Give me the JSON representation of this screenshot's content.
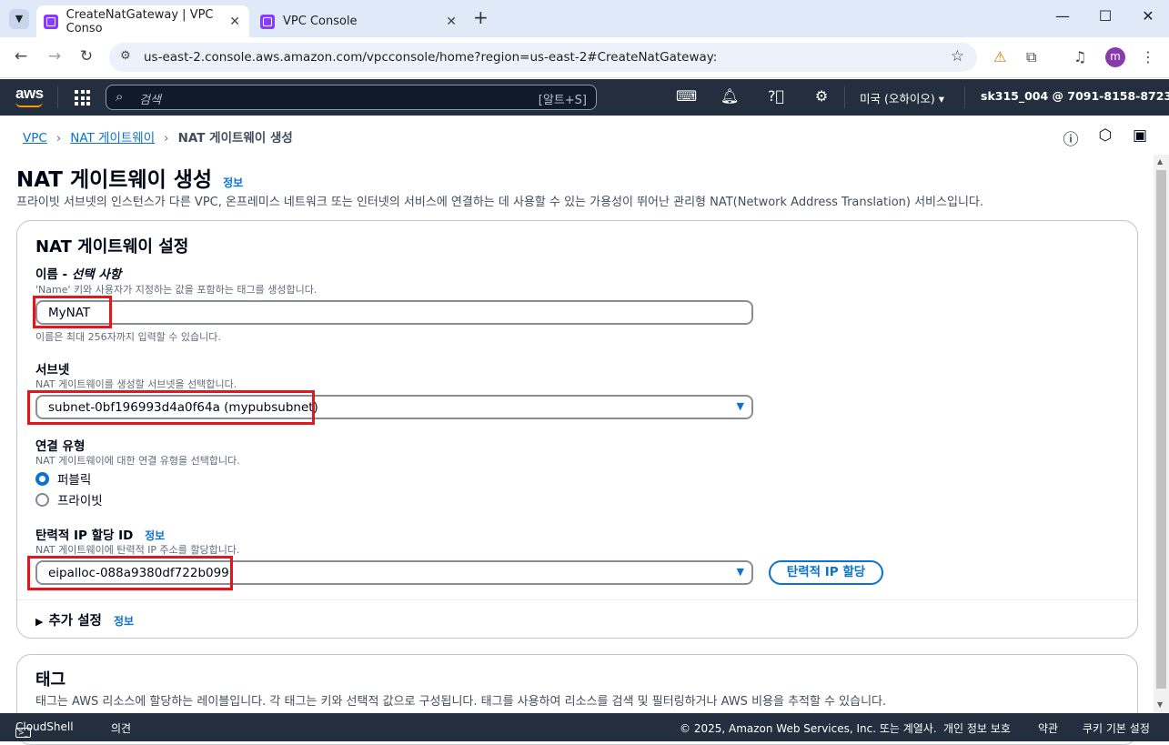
{
  "browser": {
    "tabs": [
      {
        "title": "CreateNatGateway | VPC Conso"
      },
      {
        "title": "VPC Console"
      }
    ],
    "url": "us-east-2.console.aws.amazon.com/vpcconsole/home?region=us-east-2#CreateNatGateway:",
    "profile_initial": "m"
  },
  "aws_nav": {
    "logo": "aws",
    "search_placeholder": "검색",
    "search_shortcut": "[알트+S]",
    "region": "미국 (오하이오)",
    "account": "sk315_004 @ 7091-8158-8723"
  },
  "breadcrumb": {
    "items": [
      "VPC",
      "NAT 게이트웨이"
    ],
    "current": "NAT 게이트웨이 생성"
  },
  "page": {
    "title": "NAT 게이트웨이 생성",
    "info": "정보",
    "description": "프라이빗 서브넷의 인스턴스가 다른 VPC, 온프레미스 네트워크 또는 인터넷의 서비스에 연결하는 데 사용할 수 있는 가용성이 뛰어난 관리형 NAT(Network Address Translation) 서비스입니다."
  },
  "settings": {
    "header": "NAT 게이트웨이 설정",
    "name_label": "이름 - ",
    "name_label_optional": "선택 사항",
    "name_hint": "'Name' 키와 사용자가 지정하는 값을 포함하는 태그를 생성합니다.",
    "name_value": "MyNAT",
    "name_constraint": "이름은 최대 256자까지 입력할 수 있습니다.",
    "subnet_label": "서브넷",
    "subnet_hint": "NAT 게이트웨이를 생성할 서브넷을 선택합니다.",
    "subnet_value": "subnet-0bf196993d4a0f64a (mypubsubnet)",
    "conn_label": "연결 유형",
    "conn_hint": "NAT 게이트웨이에 대한 연결 유형을 선택합니다.",
    "conn_options": [
      "퍼블릭",
      "프라이빗"
    ],
    "conn_selected": "퍼블릭",
    "eip_label": "탄력적 IP 할당 ID",
    "eip_info": "정보",
    "eip_hint": "NAT 게이트웨이에 탄력적 IP 주소를 할당합니다.",
    "eip_value": "eipalloc-088a9380df722b099",
    "eip_button": "탄력적 IP 할당",
    "additional": "추가 설정",
    "additional_info": "정보"
  },
  "tags": {
    "header": "태그",
    "description": "태그는 AWS 리소스에 할당하는 레이블입니다. 각 태그는 키와 선택적 값으로 구성됩니다. 태그를 사용하여 리소스를 검색 및 필터링하거나 AWS 비용을 추적할 수 있습니다."
  },
  "footer": {
    "cloudshell": "CloudShell",
    "feedback": "의견",
    "copyright": "© 2025, Amazon Web Services, Inc. 또는 계열사.",
    "privacy": "개인 정보 보호",
    "terms": "약관",
    "cookies": "쿠키 기본 설정"
  }
}
